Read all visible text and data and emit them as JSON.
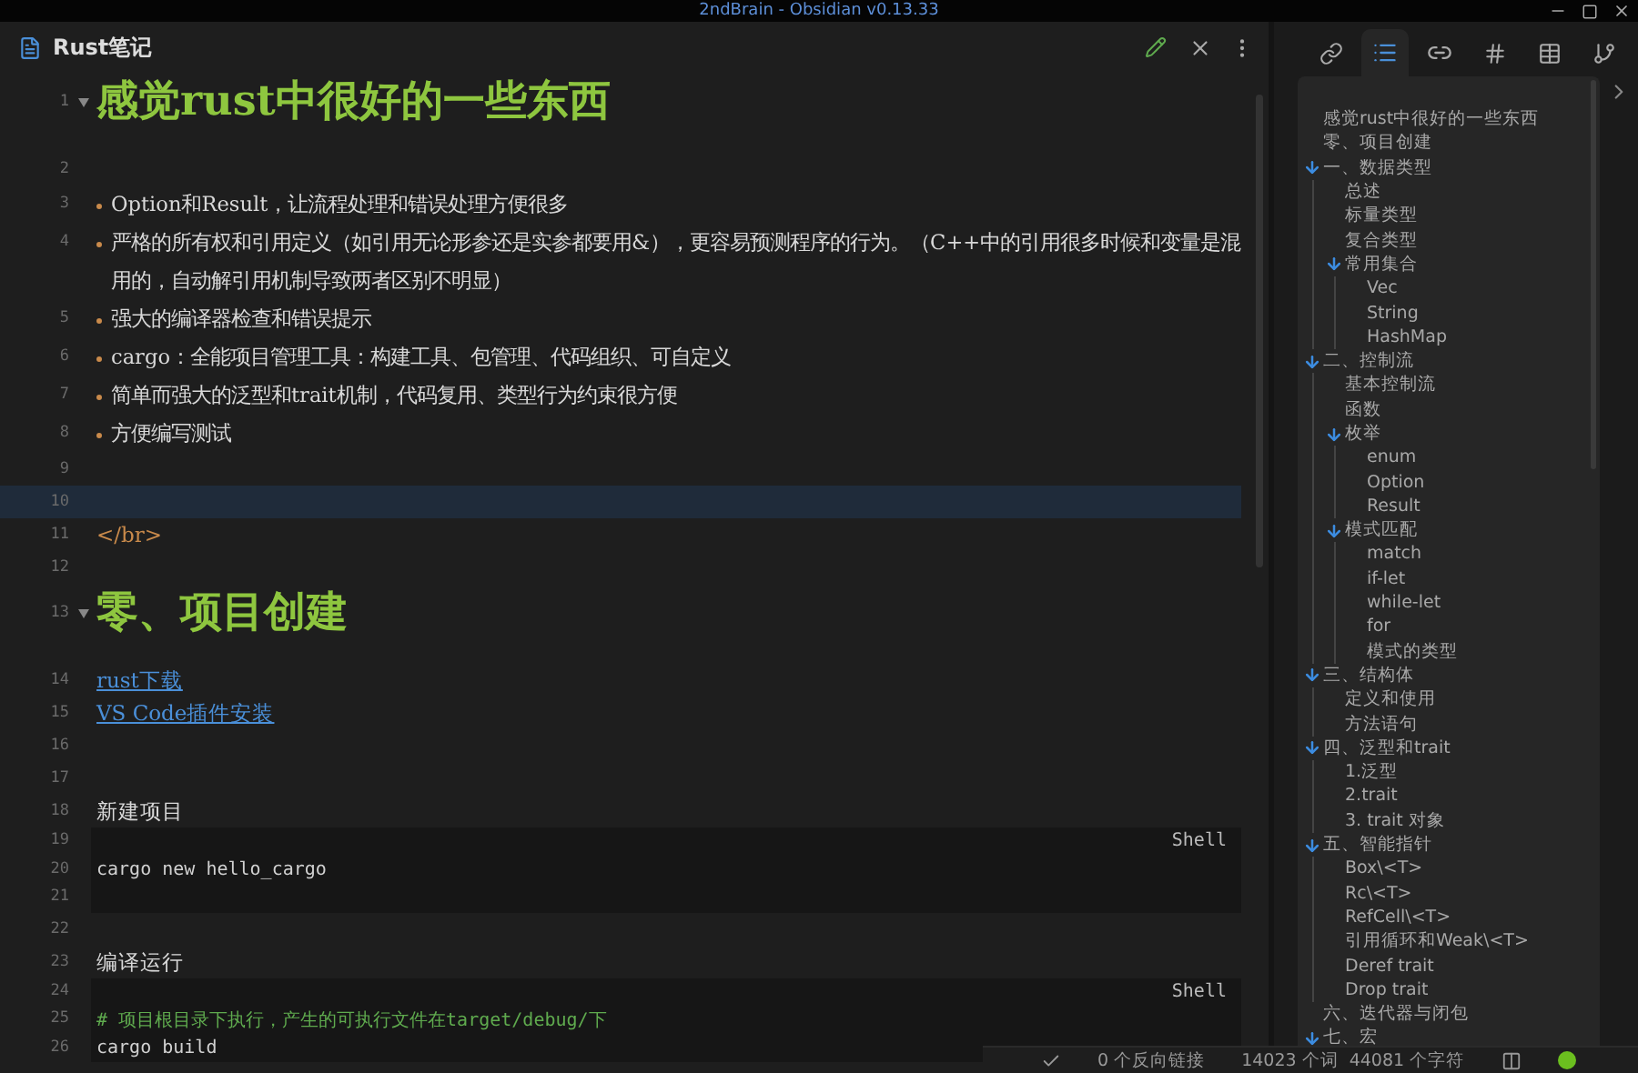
{
  "window": {
    "title": "2ndBrain - Obsidian v0.13.33"
  },
  "editor": {
    "tab_title": "Rust笔记",
    "lines": [
      {
        "number": "1",
        "kind": "heading",
        "text": "感觉rust中很好的一些东西",
        "active": false
      },
      {
        "number": "2",
        "kind": "blank",
        "active": false
      },
      {
        "number": "3",
        "kind": "bullet",
        "text": "Option和Result，让流程处理和错误处理方便很多",
        "active": false
      },
      {
        "number": "4",
        "kind": "bullet",
        "text": "严格的所有权和引用定义（如引用无论形参还是实参都要用&），更容易预测程序的行为。（C++中的引用很多时候和变量是混用的，自动解引用机制导致两者区别不明显）",
        "active": false
      },
      {
        "number": "5",
        "kind": "bullet",
        "text": "强大的编译器检查和错误提示",
        "active": false
      },
      {
        "number": "6",
        "kind": "bullet",
        "text": "cargo：全能项目管理工具：构建工具、包管理、代码组织、可自定义",
        "active": false
      },
      {
        "number": "7",
        "kind": "bullet",
        "text": "简单而强大的泛型和trait机制，代码复用、类型行为约束很方便",
        "active": false
      },
      {
        "number": "8",
        "kind": "bullet",
        "text": "方便编写测试",
        "active": false
      },
      {
        "number": "9",
        "kind": "blank",
        "active": false
      },
      {
        "number": "10",
        "kind": "blank",
        "active": true
      },
      {
        "number": "11",
        "kind": "html",
        "text": "</br>",
        "active": false
      },
      {
        "number": "12",
        "kind": "blank",
        "active": false
      },
      {
        "number": "13",
        "kind": "heading",
        "text": "零、项目创建",
        "active": false
      },
      {
        "number": "14",
        "kind": "link",
        "text": "rust下载",
        "active": false
      },
      {
        "number": "15",
        "kind": "link",
        "text": "VS Code插件安装",
        "active": false
      },
      {
        "number": "16",
        "kind": "blank",
        "active": false
      },
      {
        "number": "17",
        "kind": "blank",
        "active": false
      },
      {
        "number": "18",
        "kind": "text",
        "text": "新建项目",
        "active": false
      },
      {
        "number": "19",
        "kind": "code",
        "label": "Shell",
        "active": false
      },
      {
        "number": "20",
        "kind": "code",
        "text": "cargo new hello_cargo",
        "active": false
      },
      {
        "number": "21",
        "kind": "code",
        "active": false
      },
      {
        "number": "22",
        "kind": "blank",
        "active": false
      },
      {
        "number": "23",
        "kind": "text",
        "text": "编译运行",
        "active": false
      },
      {
        "number": "24",
        "kind": "code",
        "label": "Shell",
        "active": false
      },
      {
        "number": "25",
        "kind": "comment",
        "text": "# 项目根目录下执行，产生的可执行文件在target/debug/下",
        "active": false
      },
      {
        "number": "26",
        "kind": "code",
        "text": "cargo build",
        "active": false
      }
    ]
  },
  "sidebar": {
    "tabs": [
      {
        "kind": "backlinks",
        "selected": false
      },
      {
        "kind": "outline",
        "selected": true
      },
      {
        "kind": "outgoing",
        "selected": false
      },
      {
        "kind": "tags",
        "selected": false
      },
      {
        "kind": "table",
        "selected": false
      },
      {
        "kind": "branch",
        "selected": false
      }
    ],
    "outline": [
      {
        "text": "感觉rust中很好的一些东西"
      },
      {
        "text": "零、项目创建"
      },
      {
        "text": "一、数据类型",
        "expanded": true,
        "children": [
          {
            "text": "总述"
          },
          {
            "text": "标量类型"
          },
          {
            "text": "复合类型"
          },
          {
            "text": "常用集合",
            "expanded": true,
            "children": [
              {
                "text": "Vec"
              },
              {
                "text": "String"
              },
              {
                "text": "HashMap"
              }
            ]
          }
        ]
      },
      {
        "text": "二、控制流",
        "expanded": true,
        "children": [
          {
            "text": "基本控制流"
          },
          {
            "text": "函数"
          },
          {
            "text": "枚举",
            "expanded": true,
            "children": [
              {
                "text": "enum"
              },
              {
                "text": "Option"
              },
              {
                "text": "Result"
              }
            ]
          },
          {
            "text": "模式匹配",
            "expanded": true,
            "children": [
              {
                "text": "match"
              },
              {
                "text": "if-let"
              },
              {
                "text": "while-let"
              },
              {
                "text": "for"
              },
              {
                "text": "模式的类型"
              }
            ]
          }
        ]
      },
      {
        "text": "三、结构体",
        "expanded": true,
        "children": [
          {
            "text": "定义和使用"
          },
          {
            "text": "方法语句"
          }
        ]
      },
      {
        "text": "四、泛型和trait",
        "expanded": true,
        "children": [
          {
            "text": "1.泛型"
          },
          {
            "text": "2.trait"
          },
          {
            "text": "3. trait 对象"
          }
        ]
      },
      {
        "text": "五、智能指针",
        "expanded": true,
        "children": [
          {
            "text": "Box\\<T>"
          },
          {
            "text": "Rc\\<T>"
          },
          {
            "text": "RefCell\\<T>"
          },
          {
            "text": "引用循环和Weak\\<T>"
          },
          {
            "text": "Deref trait"
          },
          {
            "text": "Drop trait"
          }
        ]
      },
      {
        "text": "六、迭代器与闭包"
      },
      {
        "text": "七、宏",
        "expanded": true
      }
    ]
  },
  "status_bar": {
    "backlinks": "0 个反向链接",
    "words": "14023 个词",
    "characters": "44081 个字符"
  }
}
